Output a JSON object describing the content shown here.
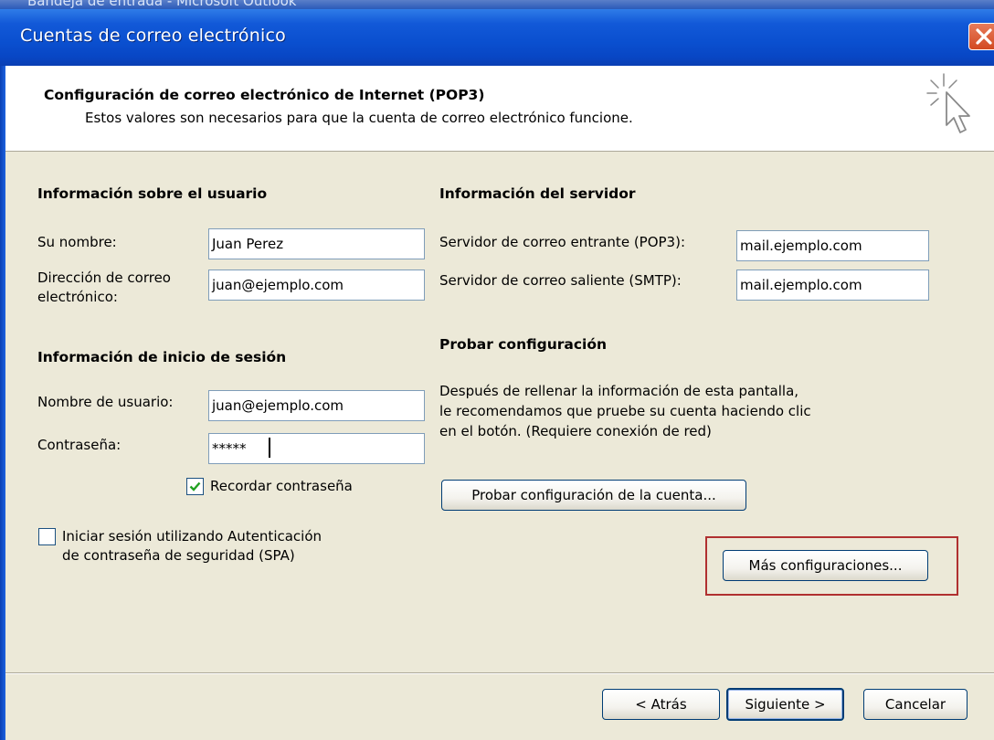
{
  "background_window_title": "Bandeja de entrada - Microsoft Outlook",
  "window": {
    "title": "Cuentas de correo electrónico",
    "close_icon": "close-icon"
  },
  "header": {
    "title": "Configuración de correo electrónico de Internet (POP3)",
    "subtitle": "Estos valores son necesarios para que la cuenta de correo electrónico funcione.",
    "icon": "cursor-sparkle-icon"
  },
  "user_info": {
    "heading": "Información sobre el usuario",
    "name_label": "Su nombre:",
    "name_value": "Juan Perez",
    "email_label_line1": "Dirección de correo",
    "email_label_line2": "electrónico:",
    "email_value": "juan@ejemplo.com"
  },
  "logon_info": {
    "heading": "Información de inicio de sesión",
    "username_label": "Nombre de usuario:",
    "username_value": "juan@ejemplo.com",
    "password_label": "Contraseña:",
    "password_value": "*****",
    "remember_label": "Recordar contraseña",
    "remember_checked": true,
    "spa_label_line1": "Iniciar sesión utilizando Autenticación",
    "spa_label_line2": "de contraseña de seguridad (SPA)",
    "spa_checked": false
  },
  "server_info": {
    "heading": "Información del servidor",
    "incoming_label": "Servidor de correo entrante (POP3):",
    "incoming_value": "mail.ejemplo.com",
    "outgoing_label": "Servidor de correo saliente (SMTP):",
    "outgoing_value": "mail.ejemplo.com"
  },
  "test_settings": {
    "heading": "Probar configuración",
    "desc_line1": "Después de rellenar la información de esta pantalla,",
    "desc_line2": "le recomendamos que pruebe su cuenta haciendo clic",
    "desc_line3": "en el botón. (Requiere conexión de red)",
    "test_button": "Probar configuración de la cuenta..."
  },
  "more_settings_button": "Más configuraciones...",
  "footer": {
    "back_button": "< Atrás",
    "next_button": "Siguiente >",
    "cancel_button": "Cancelar"
  },
  "colors": {
    "titlebar": "#0a4fcf",
    "dialog_bg": "#ece9d8",
    "highlight_border": "#b03030",
    "close_button": "#d24a22"
  }
}
